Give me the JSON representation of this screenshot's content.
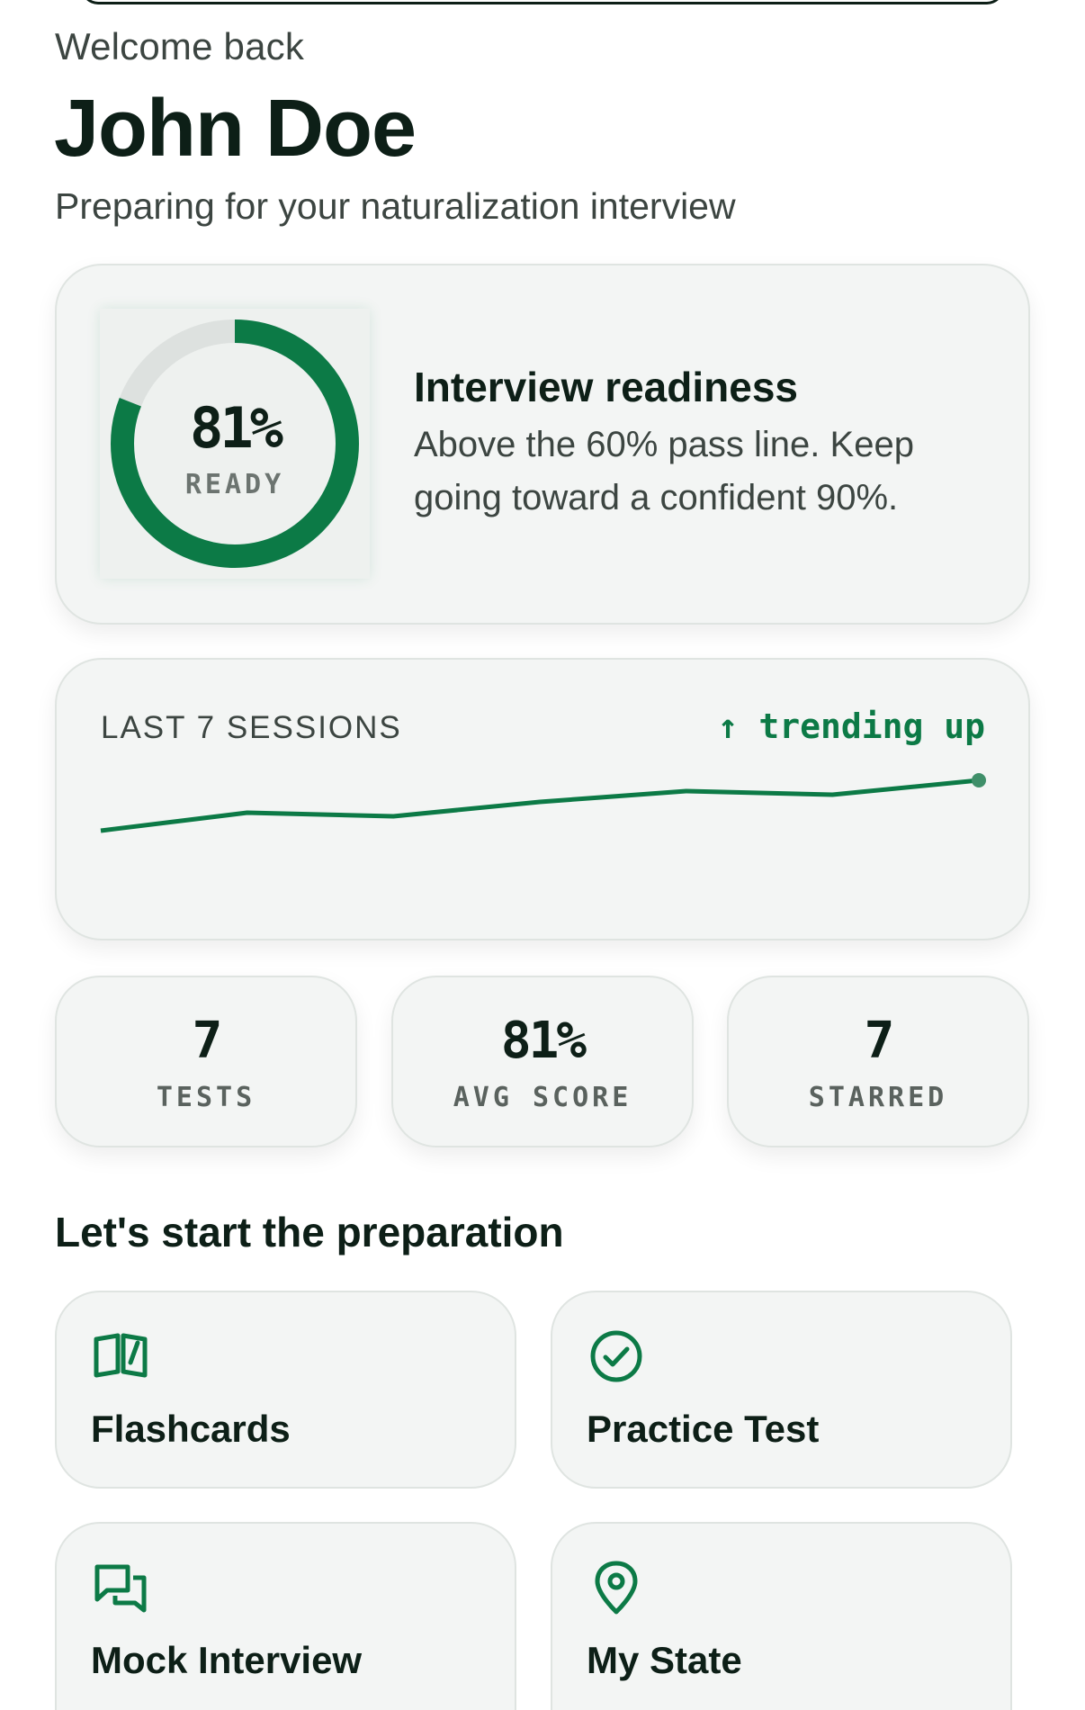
{
  "header": {
    "greeting": "Welcome back",
    "name": "John Doe",
    "subtitle": "Preparing for your naturalization interview"
  },
  "readiness": {
    "percent_label": "81%",
    "percent_value": 81,
    "ready_label": "READY",
    "title": "Interview readiness",
    "description": "Above the 60% pass line. Keep going toward a confident 90%."
  },
  "sessions": {
    "label": "LAST 7 SESSIONS",
    "trend": "↑ trending up"
  },
  "chart_data": {
    "type": "line",
    "x": [
      1,
      2,
      3,
      4,
      5,
      6,
      7
    ],
    "values": [
      70,
      75,
      74,
      78,
      81,
      80,
      84
    ],
    "ylim": [
      50,
      100
    ]
  },
  "stats": [
    {
      "value": "7",
      "label": "TESTS"
    },
    {
      "value": "81%",
      "label": "AVG SCORE"
    },
    {
      "value": "7",
      "label": "STARRED"
    }
  ],
  "actions_section": {
    "title": "Let's start the preparation"
  },
  "actions": [
    {
      "label": "Flashcards",
      "icon": "book-open-icon"
    },
    {
      "label": "Practice Test",
      "icon": "check-circle-icon"
    },
    {
      "label": "Mock Interview",
      "icon": "chat-bubbles-icon"
    },
    {
      "label": "My State",
      "icon": "map-pin-icon"
    }
  ],
  "colors": {
    "accent": "#0c7a46",
    "ring_track": "#dde1df",
    "card_bg": "#f3f5f4",
    "text_dark": "#0d1f17",
    "text_muted": "#3c4541"
  }
}
